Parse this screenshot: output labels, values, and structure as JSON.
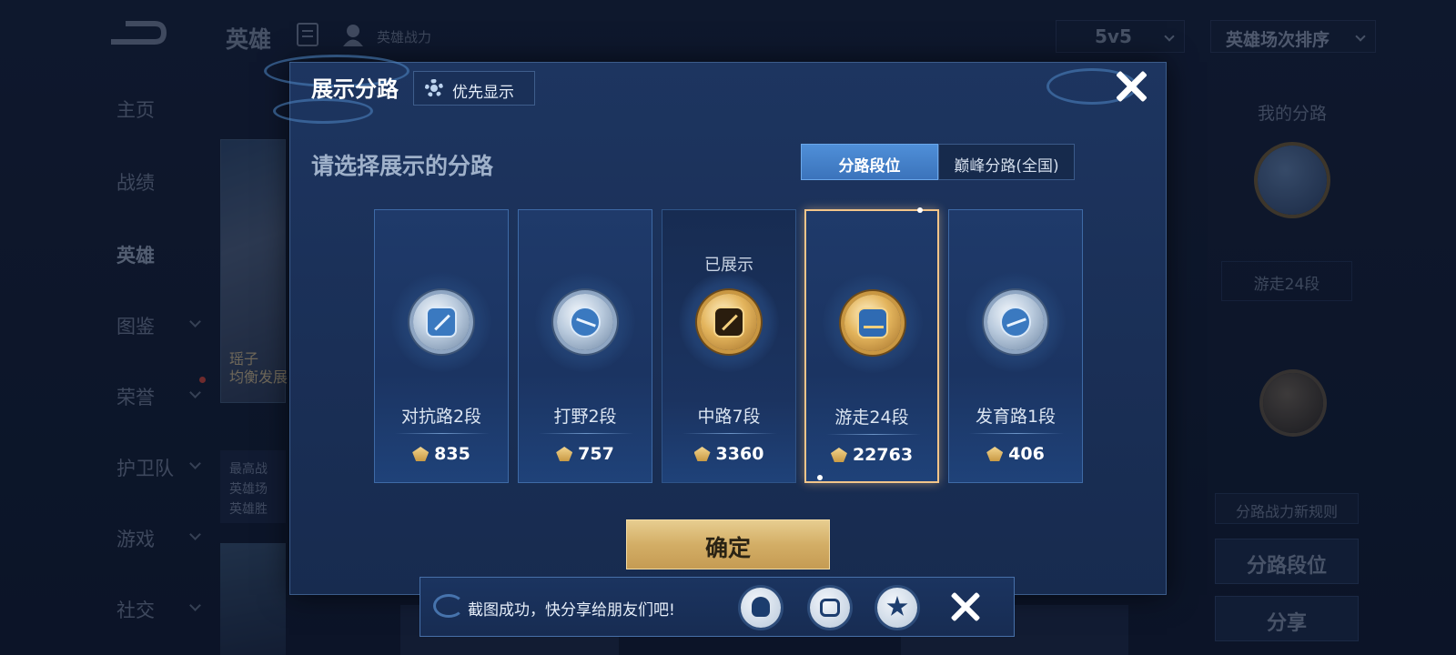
{
  "topbar": {
    "title": "英雄",
    "power_label": "英雄战力",
    "mode": "5v5",
    "sort": "英雄场次排序"
  },
  "nav": {
    "items": [
      {
        "label": "主页"
      },
      {
        "label": "战绩"
      },
      {
        "label": "英雄"
      },
      {
        "label": "图鉴"
      },
      {
        "label": "荣誉"
      },
      {
        "label": "护卫队"
      },
      {
        "label": "游戏"
      },
      {
        "label": "社交"
      }
    ],
    "active": "英雄"
  },
  "background": {
    "hero_name_line1": "瑶子",
    "hero_name_line2": "均衡发展",
    "info_line1": "最高战",
    "info_line2": "英雄场",
    "info_line3": "英雄胜"
  },
  "right_panel": {
    "title": "我的分路",
    "current_lane": "游走24段",
    "rule_label": "分路战力新规则",
    "lane_rank_btn": "分路段位",
    "share_btn": "分享"
  },
  "dialog": {
    "title": "展示分路",
    "priority_label": "优先显示",
    "subtitle": "请选择展示的分路",
    "tabs": [
      {
        "label": "分路段位",
        "active": true
      },
      {
        "label": "巅峰分路(全国)",
        "active": false
      }
    ],
    "shown_tag": "已展示",
    "lanes": [
      {
        "name": "对抗路2段",
        "points": "835",
        "badge": "silver",
        "badge_icon": "sword-shield-icon"
      },
      {
        "name": "打野2段",
        "points": "757",
        "badge": "silver",
        "badge_icon": "claw-icon"
      },
      {
        "name": "中路7段",
        "points": "3360",
        "badge": "gold",
        "badge_icon": "mid-lane-icon",
        "shown": true
      },
      {
        "name": "游走24段",
        "points": "22763",
        "badge": "gold",
        "badge_icon": "wings-icon",
        "selected": true
      },
      {
        "name": "发育路1段",
        "points": "406",
        "badge": "silver",
        "badge_icon": "marksman-icon"
      }
    ],
    "confirm_label": "确定"
  },
  "toast": {
    "message": "截图成功，快分享给朋友们吧!",
    "share_targets": [
      "qq-icon",
      "wechat-moments-icon",
      "qzone-icon"
    ]
  },
  "colors": {
    "accent_blue": "#4f8fd8",
    "gold": "#d3ae66",
    "selected_border": "#f2c58a"
  }
}
